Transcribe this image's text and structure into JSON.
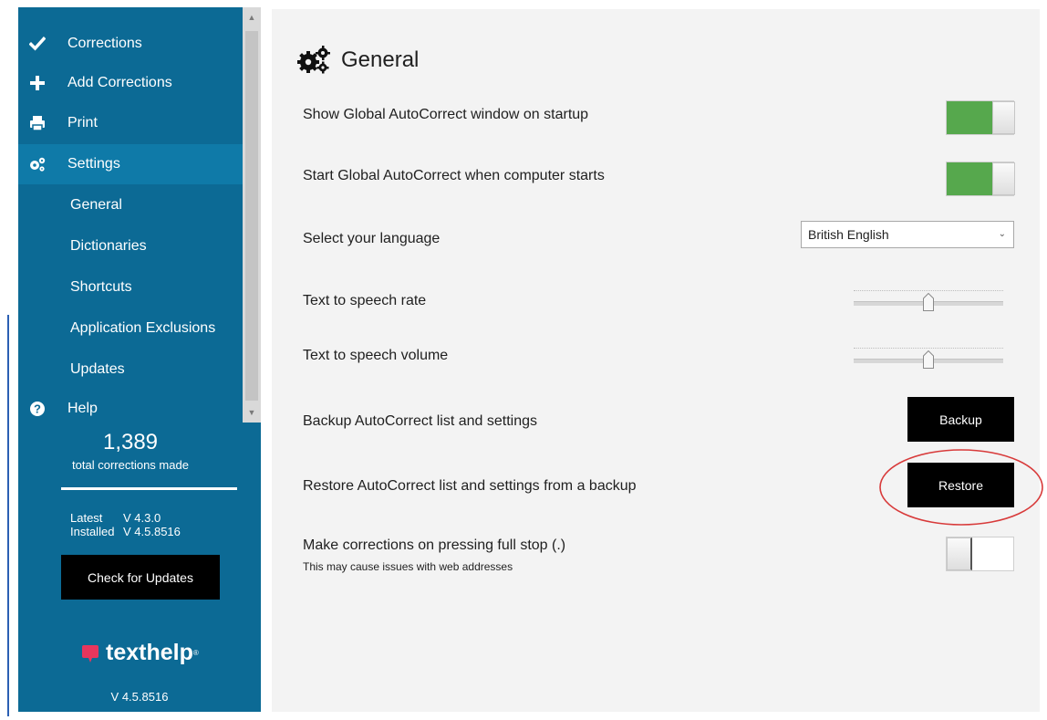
{
  "sidebar": {
    "items": [
      {
        "label": "Corrections",
        "icon": "check-icon"
      },
      {
        "label": "Add Corrections",
        "icon": "plus-icon"
      },
      {
        "label": "Print",
        "icon": "printer-icon"
      },
      {
        "label": "Settings",
        "icon": "gears-icon",
        "active": true
      }
    ],
    "subitems": [
      "General",
      "Dictionaries",
      "Shortcuts",
      "Application Exclusions",
      "Updates"
    ],
    "help": {
      "label": "Help",
      "icon": "question-circle-icon"
    },
    "stats": {
      "count": "1,389",
      "label": "total corrections made"
    },
    "versions": {
      "latest_key": "Latest",
      "latest_value": "V 4.3.0",
      "installed_key": "Installed",
      "installed_value": "V 4.5.8516"
    },
    "check_button": "Check for Updates",
    "logo_text": "texthelp",
    "logo_tm": "®",
    "version": "V 4.5.8516"
  },
  "main": {
    "title": "General",
    "title_icon": "gears-icon",
    "settings": {
      "show_window": {
        "label": "Show Global AutoCorrect window on startup",
        "on": true
      },
      "start_with_computer": {
        "label": "Start Global AutoCorrect when computer starts",
        "on": true
      },
      "language": {
        "label": "Select your language",
        "value": "British English"
      },
      "tts_rate": {
        "label": "Text to speech rate",
        "level": 0.5
      },
      "tts_volume": {
        "label": "Text to speech volume",
        "level": 0.5
      },
      "backup": {
        "label": "Backup AutoCorrect list and settings",
        "button": "Backup"
      },
      "restore": {
        "label": "Restore AutoCorrect list and settings from a backup",
        "button": "Restore"
      },
      "full_stop": {
        "label": "Make corrections on pressing full stop (.)",
        "note": "This may cause issues with web addresses",
        "on": false
      }
    }
  },
  "colors": {
    "sidebar": "#0c6a95",
    "sidebar_active": "#0f7aa8",
    "toggle_on": "#56a84d",
    "button": "#000000",
    "logo_mark": "#e8365d",
    "highlight": "#d83a3a"
  }
}
